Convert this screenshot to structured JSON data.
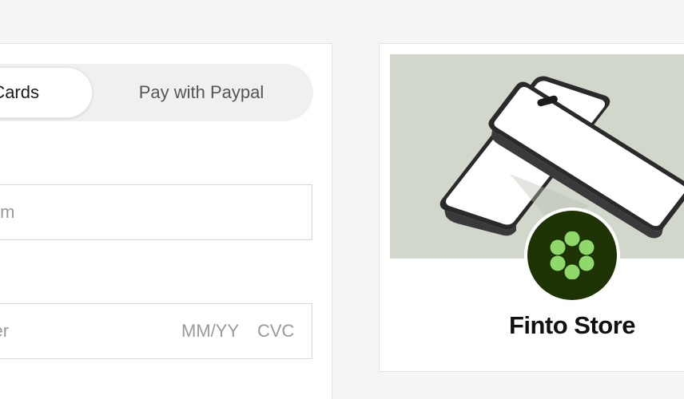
{
  "payment": {
    "tabs": [
      {
        "label": "Cards",
        "active": true
      },
      {
        "label": "Pay with Paypal",
        "active": false
      }
    ],
    "email_placeholder": "il.com",
    "card_number_placeholder": "mber",
    "expiry_placeholder": "MM/YY",
    "cvc_placeholder": "CVC"
  },
  "store": {
    "name": "Finto Store",
    "image_icon": "two-smartphones-image",
    "logo_icon": "flower-dots-logo-icon",
    "colors": {
      "image_bg": "#d2d7cc",
      "logo_bg": "#1e3304",
      "logo_dots": "#8fd86a"
    }
  }
}
